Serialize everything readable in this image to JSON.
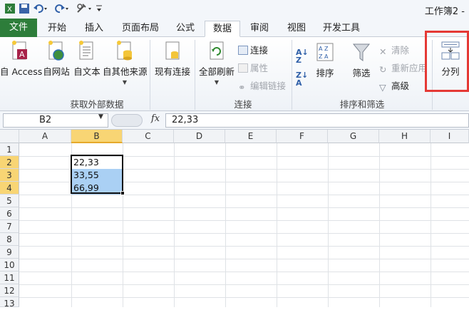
{
  "titlebar": {
    "title": "工作簿2 -",
    "undo_icon": "undo-icon",
    "redo_icon": "redo-icon"
  },
  "tabs": [
    {
      "label": "文件"
    },
    {
      "label": "开始"
    },
    {
      "label": "插入"
    },
    {
      "label": "页面布局"
    },
    {
      "label": "公式"
    },
    {
      "label": "数据"
    },
    {
      "label": "审阅"
    },
    {
      "label": "视图"
    },
    {
      "label": "开发工具"
    }
  ],
  "ribbon": {
    "external": {
      "access": "自 Access",
      "web": "自网站",
      "text": "自文本",
      "other": "自其他来源",
      "existing": "现有连接",
      "group_label": "获取外部数据"
    },
    "connections": {
      "refresh_all": "全部刷新",
      "connections": "连接",
      "properties": "属性",
      "edit_links": "编辑链接",
      "group_label": "连接"
    },
    "sort_filter": {
      "sort": "排序",
      "filter": "筛选",
      "clear": "清除",
      "reapply": "重新应用",
      "advanced": "高级",
      "group_label": "排序和筛选"
    },
    "tools": {
      "text_to_columns": "分列"
    }
  },
  "formula_bar": {
    "name_box": "B2",
    "fx": "fx",
    "value": "22,33"
  },
  "grid": {
    "columns": [
      "A",
      "B",
      "C",
      "D",
      "E",
      "F",
      "G",
      "H",
      "I"
    ],
    "rows": [
      "1",
      "2",
      "3",
      "4",
      "5",
      "6",
      "7",
      "8",
      "9",
      "10",
      "11",
      "12",
      "13"
    ],
    "cells": {
      "B2": "22,33",
      "B3": "33,55",
      "B4": "66,99"
    }
  },
  "colors": {
    "file_tab": "#2d7d3a",
    "selected_header": "#f8d574",
    "selection_fill": "#aad0f4",
    "highlight_box": "#e53935"
  }
}
